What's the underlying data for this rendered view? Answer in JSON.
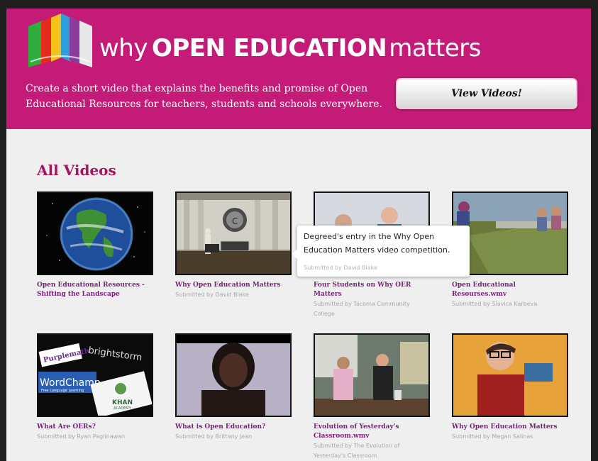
{
  "header": {
    "logo_why": "why",
    "logo_open_education": "OPEN EDUCATION",
    "logo_matters": "matters",
    "tagline": "Create a short video that explains the benefits and promise of Open Educational Resources for teachers, students and schools everywhere.",
    "view_videos_label": "View Videos!"
  },
  "section_title": "All Videos",
  "videos": [
    {
      "title": "Open Educational Resources - Shifting the Landscape",
      "submitted": ""
    },
    {
      "title": "Why Open Education Matters",
      "submitted": "Submitted by David Blake"
    },
    {
      "title": "Four Students on Why OER Matters",
      "submitted": "Submitted by Tacoma Community College"
    },
    {
      "title": "Open Educational Resourses.wmv",
      "submitted": "Submitted by Slavica Karbeva"
    },
    {
      "title": "What Are OERs?",
      "submitted": "Submitted by Ryan Paglinawan"
    },
    {
      "title": "What is Open Education?",
      "submitted": "Submitted by Brittany Jean"
    },
    {
      "title": "Evolution of Yesterday's Classroom.wmv",
      "submitted": "Submitted by The Evolution of Yesterday's Classroom"
    },
    {
      "title": "Why Open Education Matters",
      "submitted": "Submitted by Megan Salinas"
    }
  ],
  "thumb_text": {
    "purplemath": "Purplemath",
    "brightstorm": "brightstorm",
    "wordchamp": "WordChamp",
    "wordchamp_sub": "Free Language Learning",
    "khan": "KHAN",
    "khan_sub": "ACADEMY"
  },
  "tooltip": {
    "description": "Degreed's entry in the Why Open Education Matters video competition.",
    "submitted": "Submitted by David Blake"
  },
  "colors": {
    "header_bg": "#c41b78",
    "section_title": "#a2175f",
    "video_title": "#7b1f7f",
    "page_bg": "#efefef"
  }
}
